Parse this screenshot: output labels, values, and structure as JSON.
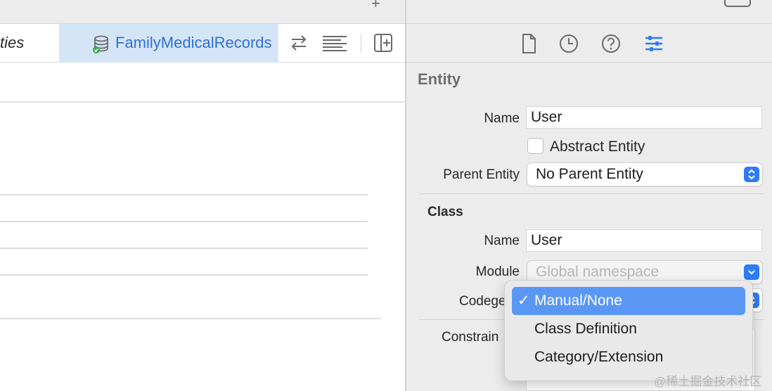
{
  "editor": {
    "breadcrumb_prev": "ties",
    "breadcrumb_active": "FamilyMedicalRecords"
  },
  "inspector": {
    "tabs": [
      "file-inspector",
      "history-inspector",
      "quick-help-inspector",
      "data-model-inspector"
    ],
    "entity_section": {
      "title": "Entity",
      "name_label": "Name",
      "name_value": "User",
      "abstract_label": "Abstract Entity",
      "abstract_checked": false,
      "parent_label": "Parent Entity",
      "parent_value": "No Parent Entity"
    },
    "class_section": {
      "title": "Class",
      "name_label": "Name",
      "name_value": "User",
      "module_label": "Module",
      "module_placeholder": "Global namespace",
      "codegen_label": "Codege",
      "constraints_label": "Constrain"
    }
  },
  "codegen_menu": {
    "items": [
      {
        "label": "Manual/None",
        "selected": true
      },
      {
        "label": "Class Definition",
        "selected": false
      },
      {
        "label": "Category/Extension",
        "selected": false
      }
    ],
    "checkmark": "✓"
  },
  "watermark": "@稀土掘金技术社区",
  "colors": {
    "accent": "#2f7cf6",
    "selection": "#5a97f4",
    "breadcrumb_bg": "#d5e5f8",
    "breadcrumb_text": "#2f6fd6"
  }
}
